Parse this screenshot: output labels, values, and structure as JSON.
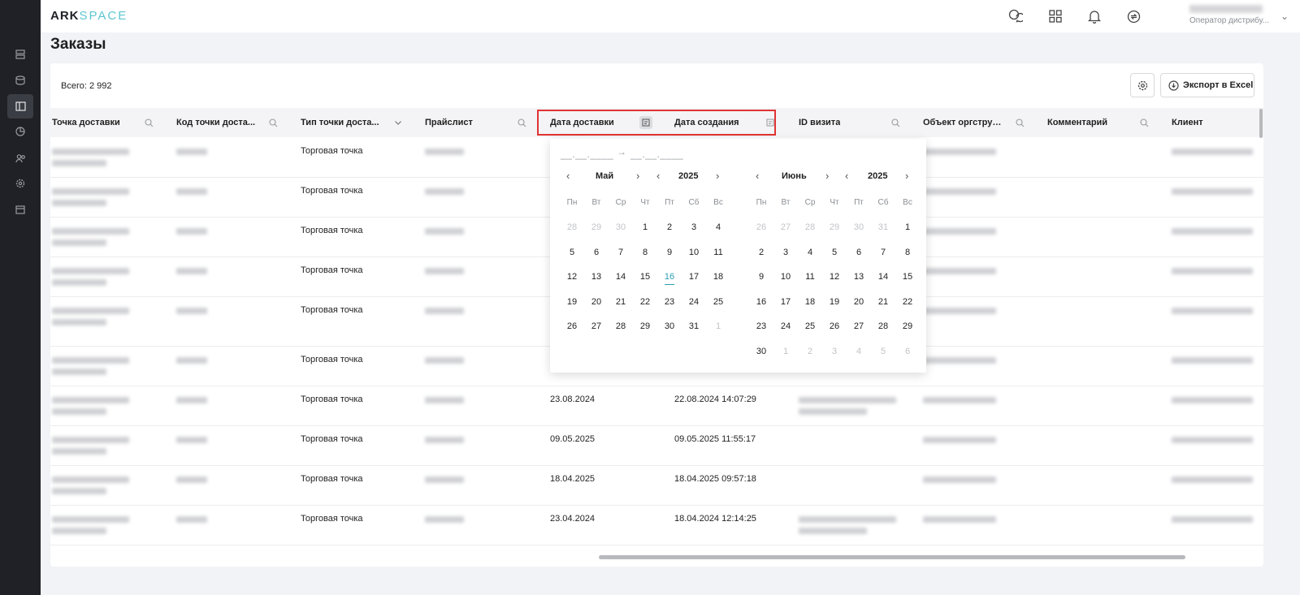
{
  "app": {
    "logo_main": "ARK",
    "logo_accent": "SPACE"
  },
  "user": {
    "name": "Шахиан Оксан...",
    "role": "Оператор дистрибу..."
  },
  "sidebar": {
    "icons": [
      "list-icon",
      "database-icon",
      "orders-icon",
      "pie-chart-icon",
      "users-icon",
      "settings-icon",
      "calendar-icon"
    ],
    "active_index": 2
  },
  "topbar": {
    "icons": [
      "chat-icon",
      "apps-grid-icon",
      "bell-icon",
      "sync-icon"
    ]
  },
  "page": {
    "title": "Заказы"
  },
  "toolbar": {
    "total": "Всего: 2 992",
    "export_label": "Экспорт в Excel"
  },
  "table": {
    "columns": [
      "Точка доставки",
      "Код точки доста...",
      "Тип точки доста...",
      "Прайслист",
      "Дата доставки",
      "Дата создания",
      "ID визита",
      "Объект оргструкт...",
      "Комментарий",
      "Клиент"
    ],
    "rows": [
      {
        "type": "Торговая точка",
        "delivery_date": "",
        "created": ""
      },
      {
        "type": "Торговая точка",
        "delivery_date": "",
        "created": ""
      },
      {
        "type": "Торговая точка",
        "delivery_date": "",
        "created": ""
      },
      {
        "type": "Торговая точка",
        "delivery_date": "",
        "created": ""
      },
      {
        "type": "Торговая точка",
        "delivery_date": "",
        "created": ""
      },
      {
        "type": "Торговая точка",
        "delivery_date": "",
        "created": ""
      },
      {
        "type": "Торговая точка",
        "delivery_date": "23.08.2024",
        "created": "22.08.2024 14:07:29"
      },
      {
        "type": "Торговая точка",
        "delivery_date": "09.05.2025",
        "created": "09.05.2025 11:55:17"
      },
      {
        "type": "Торговая точка",
        "delivery_date": "18.04.2025",
        "created": "18.04.2025 09:57:18"
      },
      {
        "type": "Торговая точка",
        "delivery_date": "23.04.2024",
        "created": "18.04.2024 12:14:25"
      }
    ]
  },
  "datepicker": {
    "start_placeholder": "__.__.____",
    "end_placeholder": "__.__.____",
    "arrow": "→",
    "weekdays": [
      "Пн",
      "Вт",
      "Ср",
      "Чт",
      "Пт",
      "Сб",
      "Вс"
    ],
    "left": {
      "month": "Май",
      "year": "2025",
      "weeks": [
        [
          "28",
          "29",
          "30",
          "1",
          "2",
          "3",
          "4"
        ],
        [
          "5",
          "6",
          "7",
          "8",
          "9",
          "10",
          "11"
        ],
        [
          "12",
          "13",
          "14",
          "15",
          "16",
          "17",
          "18"
        ],
        [
          "19",
          "20",
          "21",
          "22",
          "23",
          "24",
          "25"
        ],
        [
          "26",
          "27",
          "28",
          "29",
          "30",
          "31",
          "1"
        ]
      ]
    },
    "right": {
      "month": "Июнь",
      "year": "2025",
      "weeks": [
        [
          "26",
          "27",
          "28",
          "29",
          "30",
          "31",
          "1"
        ],
        [
          "2",
          "3",
          "4",
          "5",
          "6",
          "7",
          "8"
        ],
        [
          "9",
          "10",
          "11",
          "12",
          "13",
          "14",
          "15"
        ],
        [
          "16",
          "17",
          "18",
          "19",
          "20",
          "21",
          "22"
        ],
        [
          "23",
          "24",
          "25",
          "26",
          "27",
          "28",
          "29"
        ],
        [
          "30",
          "1",
          "2",
          "3",
          "4",
          "5",
          "6"
        ]
      ]
    },
    "today": "16"
  }
}
